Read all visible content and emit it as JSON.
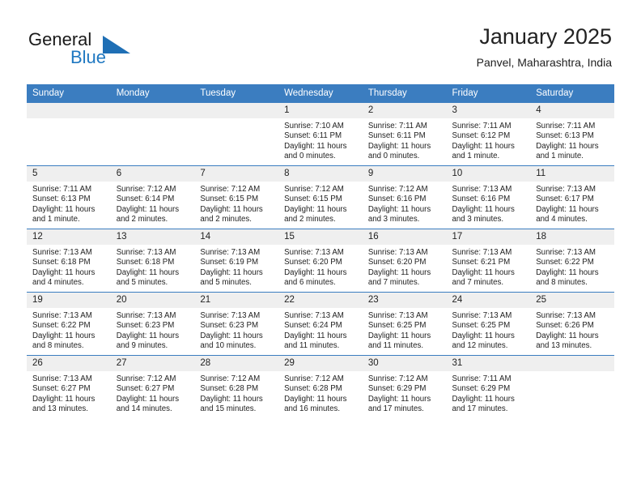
{
  "brand": {
    "name_top": "General",
    "name_bottom": "Blue",
    "triangle_color": "#1f6fb5",
    "blue_color": "#1f78c1"
  },
  "header": {
    "title": "January 2025",
    "subtitle": "Panvel, Maharashtra, India"
  },
  "theme": {
    "header_blue": "#3b7dc0",
    "daynum_band": "#efefef",
    "text": "#222222"
  },
  "weekday_headers": [
    "Sunday",
    "Monday",
    "Tuesday",
    "Wednesday",
    "Thursday",
    "Friday",
    "Saturday"
  ],
  "labels": {
    "sunrise_prefix": "Sunrise:",
    "sunset_prefix": "Sunset:",
    "daylight_prefix": "Daylight:"
  },
  "weeks": [
    [
      {
        "day": "",
        "empty": true
      },
      {
        "day": "",
        "empty": true
      },
      {
        "day": "",
        "empty": true
      },
      {
        "day": "1",
        "sunrise": "Sunrise: 7:10 AM",
        "sunset": "Sunset: 6:11 PM",
        "daylight": "Daylight: 11 hours and 0 minutes."
      },
      {
        "day": "2",
        "sunrise": "Sunrise: 7:11 AM",
        "sunset": "Sunset: 6:11 PM",
        "daylight": "Daylight: 11 hours and 0 minutes."
      },
      {
        "day": "3",
        "sunrise": "Sunrise: 7:11 AM",
        "sunset": "Sunset: 6:12 PM",
        "daylight": "Daylight: 11 hours and 1 minute."
      },
      {
        "day": "4",
        "sunrise": "Sunrise: 7:11 AM",
        "sunset": "Sunset: 6:13 PM",
        "daylight": "Daylight: 11 hours and 1 minute."
      }
    ],
    [
      {
        "day": "5",
        "sunrise": "Sunrise: 7:11 AM",
        "sunset": "Sunset: 6:13 PM",
        "daylight": "Daylight: 11 hours and 1 minute."
      },
      {
        "day": "6",
        "sunrise": "Sunrise: 7:12 AM",
        "sunset": "Sunset: 6:14 PM",
        "daylight": "Daylight: 11 hours and 2 minutes."
      },
      {
        "day": "7",
        "sunrise": "Sunrise: 7:12 AM",
        "sunset": "Sunset: 6:15 PM",
        "daylight": "Daylight: 11 hours and 2 minutes."
      },
      {
        "day": "8",
        "sunrise": "Sunrise: 7:12 AM",
        "sunset": "Sunset: 6:15 PM",
        "daylight": "Daylight: 11 hours and 2 minutes."
      },
      {
        "day": "9",
        "sunrise": "Sunrise: 7:12 AM",
        "sunset": "Sunset: 6:16 PM",
        "daylight": "Daylight: 11 hours and 3 minutes."
      },
      {
        "day": "10",
        "sunrise": "Sunrise: 7:13 AM",
        "sunset": "Sunset: 6:16 PM",
        "daylight": "Daylight: 11 hours and 3 minutes."
      },
      {
        "day": "11",
        "sunrise": "Sunrise: 7:13 AM",
        "sunset": "Sunset: 6:17 PM",
        "daylight": "Daylight: 11 hours and 4 minutes."
      }
    ],
    [
      {
        "day": "12",
        "sunrise": "Sunrise: 7:13 AM",
        "sunset": "Sunset: 6:18 PM",
        "daylight": "Daylight: 11 hours and 4 minutes."
      },
      {
        "day": "13",
        "sunrise": "Sunrise: 7:13 AM",
        "sunset": "Sunset: 6:18 PM",
        "daylight": "Daylight: 11 hours and 5 minutes."
      },
      {
        "day": "14",
        "sunrise": "Sunrise: 7:13 AM",
        "sunset": "Sunset: 6:19 PM",
        "daylight": "Daylight: 11 hours and 5 minutes."
      },
      {
        "day": "15",
        "sunrise": "Sunrise: 7:13 AM",
        "sunset": "Sunset: 6:20 PM",
        "daylight": "Daylight: 11 hours and 6 minutes."
      },
      {
        "day": "16",
        "sunrise": "Sunrise: 7:13 AM",
        "sunset": "Sunset: 6:20 PM",
        "daylight": "Daylight: 11 hours and 7 minutes."
      },
      {
        "day": "17",
        "sunrise": "Sunrise: 7:13 AM",
        "sunset": "Sunset: 6:21 PM",
        "daylight": "Daylight: 11 hours and 7 minutes."
      },
      {
        "day": "18",
        "sunrise": "Sunrise: 7:13 AM",
        "sunset": "Sunset: 6:22 PM",
        "daylight": "Daylight: 11 hours and 8 minutes."
      }
    ],
    [
      {
        "day": "19",
        "sunrise": "Sunrise: 7:13 AM",
        "sunset": "Sunset: 6:22 PM",
        "daylight": "Daylight: 11 hours and 8 minutes."
      },
      {
        "day": "20",
        "sunrise": "Sunrise: 7:13 AM",
        "sunset": "Sunset: 6:23 PM",
        "daylight": "Daylight: 11 hours and 9 minutes."
      },
      {
        "day": "21",
        "sunrise": "Sunrise: 7:13 AM",
        "sunset": "Sunset: 6:23 PM",
        "daylight": "Daylight: 11 hours and 10 minutes."
      },
      {
        "day": "22",
        "sunrise": "Sunrise: 7:13 AM",
        "sunset": "Sunset: 6:24 PM",
        "daylight": "Daylight: 11 hours and 11 minutes."
      },
      {
        "day": "23",
        "sunrise": "Sunrise: 7:13 AM",
        "sunset": "Sunset: 6:25 PM",
        "daylight": "Daylight: 11 hours and 11 minutes."
      },
      {
        "day": "24",
        "sunrise": "Sunrise: 7:13 AM",
        "sunset": "Sunset: 6:25 PM",
        "daylight": "Daylight: 11 hours and 12 minutes."
      },
      {
        "day": "25",
        "sunrise": "Sunrise: 7:13 AM",
        "sunset": "Sunset: 6:26 PM",
        "daylight": "Daylight: 11 hours and 13 minutes."
      }
    ],
    [
      {
        "day": "26",
        "sunrise": "Sunrise: 7:13 AM",
        "sunset": "Sunset: 6:27 PM",
        "daylight": "Daylight: 11 hours and 13 minutes."
      },
      {
        "day": "27",
        "sunrise": "Sunrise: 7:12 AM",
        "sunset": "Sunset: 6:27 PM",
        "daylight": "Daylight: 11 hours and 14 minutes."
      },
      {
        "day": "28",
        "sunrise": "Sunrise: 7:12 AM",
        "sunset": "Sunset: 6:28 PM",
        "daylight": "Daylight: 11 hours and 15 minutes."
      },
      {
        "day": "29",
        "sunrise": "Sunrise: 7:12 AM",
        "sunset": "Sunset: 6:28 PM",
        "daylight": "Daylight: 11 hours and 16 minutes."
      },
      {
        "day": "30",
        "sunrise": "Sunrise: 7:12 AM",
        "sunset": "Sunset: 6:29 PM",
        "daylight": "Daylight: 11 hours and 17 minutes."
      },
      {
        "day": "31",
        "sunrise": "Sunrise: 7:11 AM",
        "sunset": "Sunset: 6:29 PM",
        "daylight": "Daylight: 11 hours and 17 minutes."
      },
      {
        "day": "",
        "empty": true
      }
    ]
  ]
}
